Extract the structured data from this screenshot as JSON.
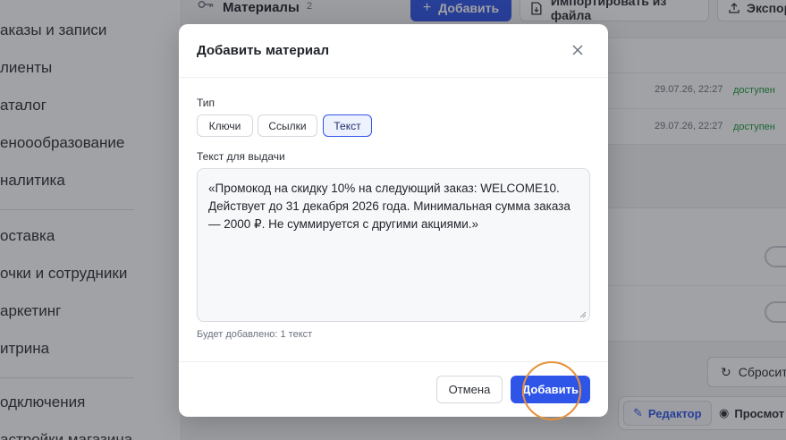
{
  "sidebar": {
    "items": [
      {
        "label": "аказы и записи"
      },
      {
        "label": "лиенты"
      },
      {
        "label": "аталог"
      },
      {
        "label": "еноообразование"
      },
      {
        "label": "налитика"
      },
      {
        "label": "оставка"
      },
      {
        "label": "очки и сотрудники"
      },
      {
        "label": "аркетинг"
      },
      {
        "label": "итрина"
      },
      {
        "label": "одключения"
      },
      {
        "label": "астройки магазина"
      }
    ]
  },
  "main": {
    "section_title": "Материалы",
    "section_count": "2",
    "add_button": "Добавить",
    "import_button": "Импортировать из файла",
    "export_button": "Экспор",
    "rows": [
      {
        "date": "29.07.26, 22:27",
        "status": "доступен"
      },
      {
        "date": "29.07.26, 22:27",
        "status": "доступен"
      }
    ],
    "reset_button": "Сбросит",
    "editor_tab": "Редактор",
    "preview_tab": "Просмот"
  },
  "modal": {
    "title": "Добавить материал",
    "type_label": "Тип",
    "types": [
      {
        "label": "Ключи",
        "active": false
      },
      {
        "label": "Ссылки",
        "active": false
      },
      {
        "label": "Текст",
        "active": true
      }
    ],
    "text_label": "Текст для выдачи",
    "text_value": "«Промокод на скидку 10% на следующий заказ: WELCOME10. Действует до 31 декабря 2026 года. Минимальная сумма заказа — 2000 ₽. Не суммируется с другими акциями.»",
    "hint": "Будет добавлено: 1 текст",
    "cancel_button": "Отмена",
    "submit_button": "Добавить"
  },
  "colors": {
    "accent": "#2f55e8",
    "status_ok": "#1c9a3e",
    "click_marker": "#e8913a"
  }
}
